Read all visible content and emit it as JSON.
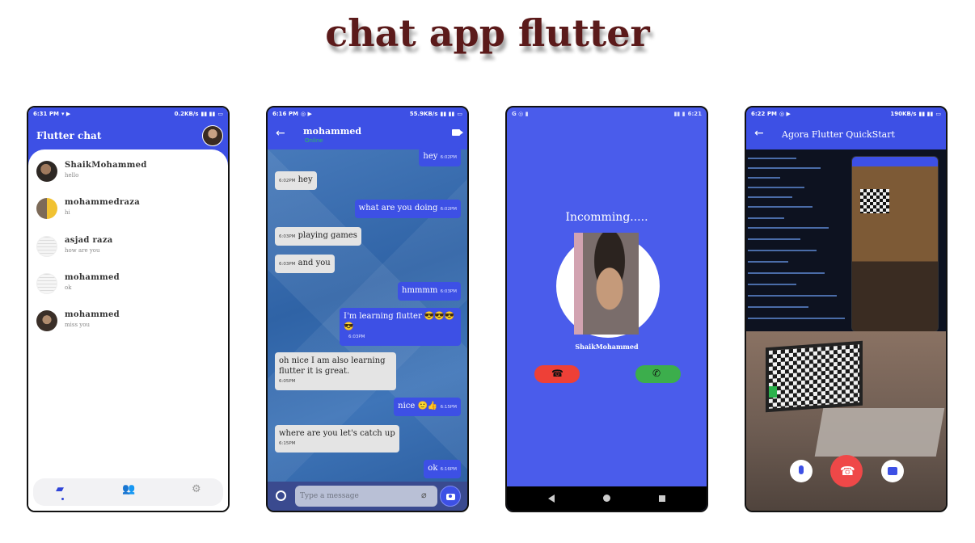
{
  "page_title": "chat app flutter",
  "colors": {
    "title": "#5b1a1a",
    "primary": "#3d50e5",
    "reject": "#ee4037",
    "accept": "#3cae4c",
    "online": "#2fbf5a"
  },
  "phone_list": {
    "status": {
      "time": "6:31 PM",
      "speed": "0.2KB/s"
    },
    "app_title": "Flutter chat",
    "chats": [
      {
        "name": "ShaikMohammed",
        "last_message": "hello"
      },
      {
        "name": "mohammedraza",
        "last_message": "hi"
      },
      {
        "name": "asjad raza",
        "last_message": "how are you"
      },
      {
        "name": "mohammed",
        "last_message": "ok"
      },
      {
        "name": "mohammed",
        "last_message": "miss you"
      }
    ],
    "nav_icons": [
      "chat-icon",
      "users-icon",
      "settings-icon"
    ]
  },
  "phone_chat": {
    "status": {
      "time": "6:16 PM",
      "speed": "55.9KB/s"
    },
    "contact_name": "mohammed",
    "contact_status": "Online",
    "messages": [
      {
        "dir": "out",
        "text": "hey",
        "time": "6:02PM"
      },
      {
        "dir": "in",
        "text": "hey",
        "time": "6:02PM"
      },
      {
        "dir": "out",
        "text": "what are you doing",
        "time": "6:02PM"
      },
      {
        "dir": "in",
        "text": "playing games",
        "time": "6:03PM"
      },
      {
        "dir": "in",
        "text": "and you",
        "time": "6:03PM"
      },
      {
        "dir": "out",
        "text": "hmmmm",
        "time": "6:03PM"
      },
      {
        "dir": "out",
        "text": "I'm learning flutter 😎😎😎",
        "text2": "😎",
        "time": "6:03PM"
      },
      {
        "dir": "in",
        "text": "oh nice I am also learning",
        "text2": "flutter it is great.",
        "time": "6:05PM"
      },
      {
        "dir": "out",
        "text": "nice 🙂👍",
        "time": "6:15PM"
      },
      {
        "dir": "in",
        "text": "where are you let's catch up",
        "time": "6:15PM"
      },
      {
        "dir": "out",
        "text": "ok",
        "time": "6:16PM"
      }
    ],
    "input_placeholder": "Type a message"
  },
  "phone_call": {
    "status": {
      "time": "6:21"
    },
    "incoming_label": "Incomming.....",
    "caller_name": "ShaikMohammed"
  },
  "phone_agora": {
    "status": {
      "time": "6:22 PM",
      "speed": "190KB/s"
    },
    "app_title": "Agora Flutter QuickStart"
  }
}
